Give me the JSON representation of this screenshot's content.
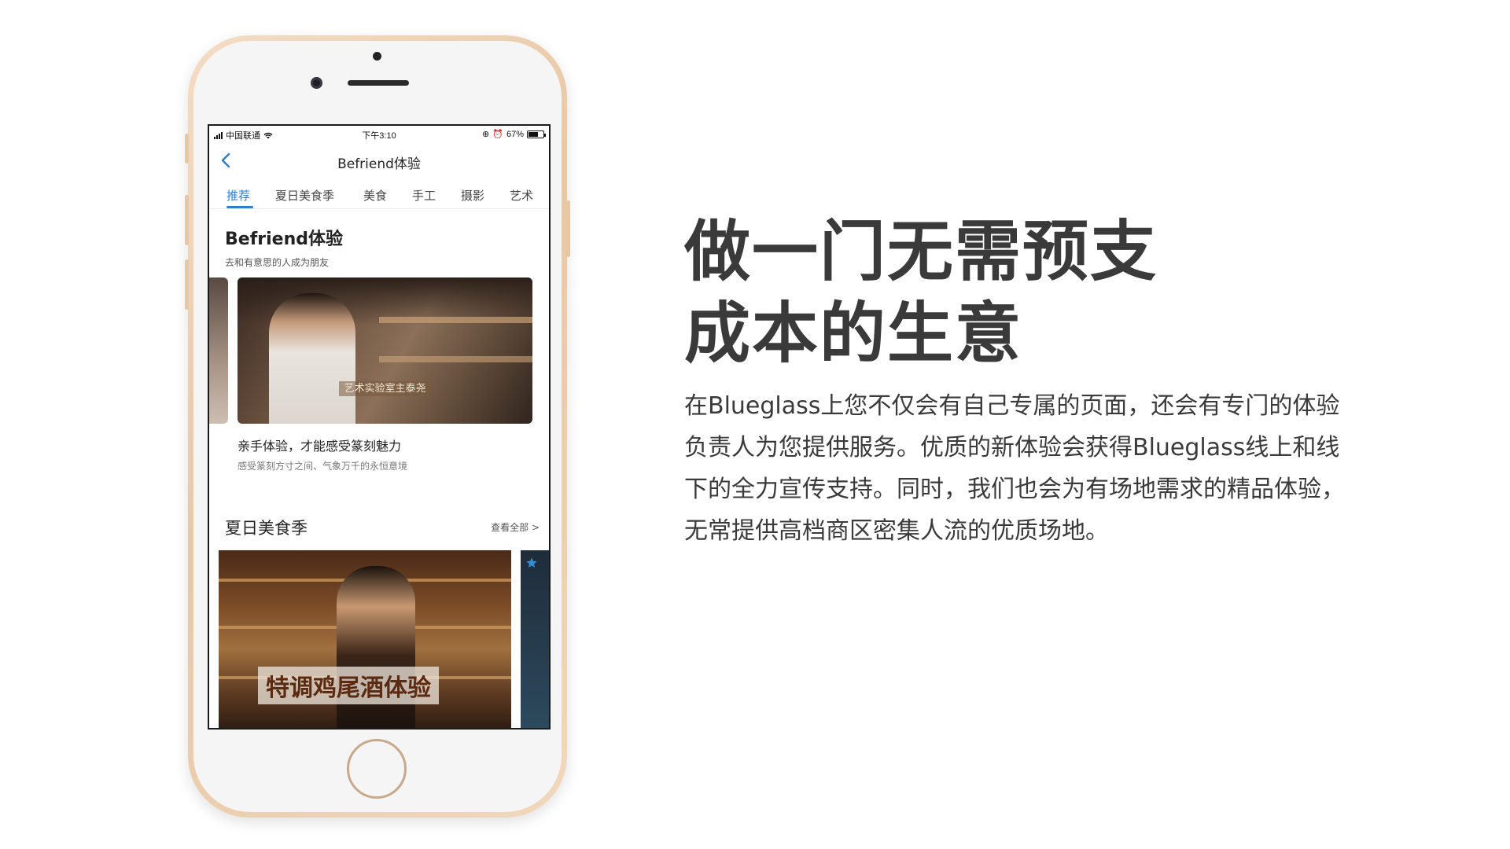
{
  "phone": {
    "status_bar": {
      "carrier": "中国联通",
      "time": "下午3:10",
      "battery_text": "67%",
      "battery_level": 0.67
    },
    "nav": {
      "title": "Befriend体验",
      "back_icon": "chevron-left-icon"
    },
    "tabs": [
      "推荐",
      "夏日美食季",
      "美食",
      "手工",
      "摄影",
      "艺术"
    ],
    "active_tab": "推荐",
    "section1": {
      "title": "Befriend体验",
      "subtitle": "去和有意思的人成为朋友",
      "card": {
        "image_caption": "艺术实验室主泰尧",
        "title": "亲手体验，才能感受篆刻魅力",
        "desc": "感受篆刻方寸之间、气象万千的永恒意境"
      }
    },
    "section2": {
      "title": "夏日美食季",
      "view_all": "查看全部 >",
      "card": {
        "image_caption": "特调鸡尾酒体验"
      }
    }
  },
  "headline": {
    "line1": "做一门无需预支",
    "line2": "成本的生意"
  },
  "body": "在Blueglass上您不仅会有自己专属的页面，还会有专门的体验负责人为您提供服务。优质的新体验会获得Blueglass线上和线下的全力宣传支持。同时，我们也会为有场地需求的精品体验，无常提供高档商区密集人流的优质场地。",
  "colors": {
    "accent": "#2f7fd0",
    "text": "#3a3a3a",
    "phone_gold": "#e8c8a6"
  }
}
